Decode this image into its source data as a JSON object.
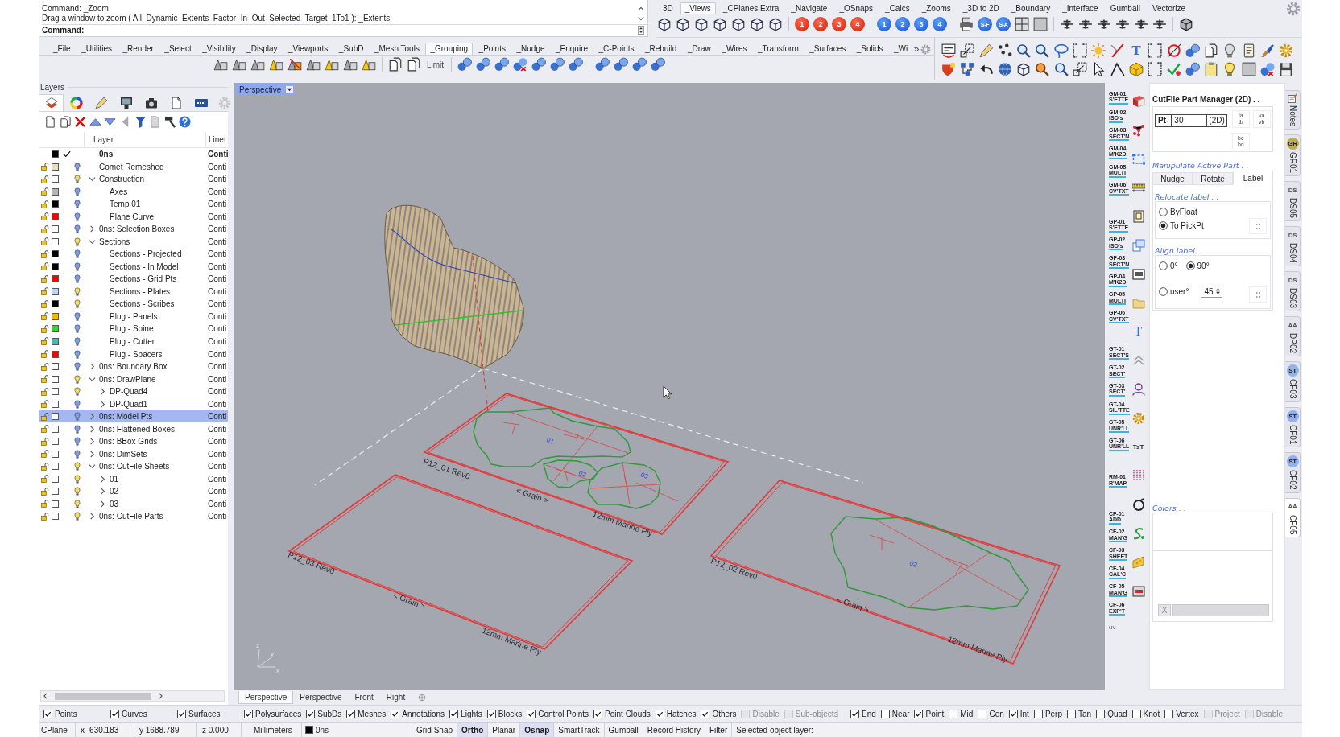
{
  "command_area": {
    "history": [
      "Command: _Zoom",
      "Drag a window to zoom ( All  Dynamic  Extents  Factor  In  Out  Selected  Target  1To1 ): _Extents"
    ],
    "prompt": "Command:"
  },
  "view_toolbar": {
    "tabs": [
      {
        "label": "3D",
        "selected": false
      },
      {
        "label": "_Views",
        "selected": true
      },
      {
        "label": "_CPlanes Extra",
        "selected": false
      },
      {
        "label": "_Navigate",
        "selected": false
      },
      {
        "label": "_OSnaps",
        "selected": false
      },
      {
        "label": "_Calcs",
        "selected": false
      },
      {
        "label": "_Zooms",
        "selected": false
      },
      {
        "label": "_3D to 2D",
        "selected": false
      },
      {
        "label": "_Boundary",
        "selected": false
      },
      {
        "label": "_Interface",
        "selected": false
      },
      {
        "label": "Gumball",
        "selected": false
      },
      {
        "label": "Vectorize",
        "selected": false
      }
    ],
    "red_buttons": [
      "1",
      "2",
      "3",
      "4"
    ],
    "blue_buttons": [
      "1",
      "2",
      "3",
      "4"
    ],
    "snap_buttons": [
      "S-F",
      "S-A"
    ]
  },
  "main_toolbar": {
    "tabs": [
      {
        "label": "_File",
        "selected": false
      },
      {
        "label": "_Utilities",
        "selected": false
      },
      {
        "label": "_Render",
        "selected": false
      },
      {
        "label": "_Select",
        "selected": false
      },
      {
        "label": "_Visibility",
        "selected": false
      },
      {
        "label": "_Display",
        "selected": false
      },
      {
        "label": "_Viewports",
        "selected": false
      },
      {
        "label": "_SubD",
        "selected": false
      },
      {
        "label": "_Mesh Tools",
        "selected": false
      },
      {
        "label": "_Grouping",
        "selected": true
      },
      {
        "label": "_Points",
        "selected": false
      },
      {
        "label": "_Nudge",
        "selected": false
      },
      {
        "label": "_Enquire",
        "selected": false
      },
      {
        "label": "_C-Points",
        "selected": false
      },
      {
        "label": "_Rebuild",
        "selected": false
      },
      {
        "label": "_Draw",
        "selected": false
      },
      {
        "label": "_Wires",
        "selected": false
      },
      {
        "label": "_Transform",
        "selected": false
      },
      {
        "label": "_Surfaces",
        "selected": false
      },
      {
        "label": "_Solids",
        "selected": false
      },
      {
        "label": "_Wi",
        "selected": false
      }
    ],
    "overflow": "»",
    "limit_button": "Limit",
    "text_button": "T"
  },
  "layers_panel": {
    "title": "Layers",
    "columns": [
      "Layer",
      "Linet"
    ],
    "layers": [
      {
        "name": "0ns",
        "color": "#000000",
        "current": true,
        "selected": false,
        "expandable": false,
        "linetype": "Conti"
      },
      {
        "name": "Comet Remeshed",
        "color": "#e9dcc2",
        "bulb": {
          "color": "#7d9fe2"
        },
        "current": false,
        "selected": false,
        "expandable": false,
        "linetype": "Conti"
      },
      {
        "name": "Construction",
        "color": "#ffffff",
        "bulb": {
          "color": "#f4dc5c"
        },
        "current": false,
        "selected": false,
        "expandable": true,
        "expanded": true,
        "linetype": "Conti",
        "children": [
          {
            "name": "Axes",
            "color": "#b4b4b4",
            "bulb": {
              "color": "#7d9fe2"
            },
            "current": false,
            "selected": false,
            "expandable": false,
            "linetype": "Conti"
          },
          {
            "name": "Temp 01",
            "color": "#000000",
            "bulb": {
              "color": "#7d9fe2"
            },
            "current": false,
            "selected": false,
            "expandable": false,
            "linetype": "Conti"
          },
          {
            "name": "Plane Curve",
            "color": "#ff0000",
            "bulb": {
              "color": "#7d9fe2"
            },
            "current": false,
            "selected": false,
            "expandable": false,
            "linetype": "Conti"
          }
        ]
      },
      {
        "name": "0ns: Selection Boxes",
        "color": "#ffffff",
        "bulb": {
          "color": "#7d9fe2"
        },
        "current": false,
        "selected": false,
        "expandable": true,
        "expanded": false,
        "linetype": "Conti"
      },
      {
        "name": "Sections",
        "color": "#ffffff",
        "bulb": {
          "color": "#f4dc5c"
        },
        "current": false,
        "selected": false,
        "expandable": true,
        "expanded": true,
        "linetype": "Conti",
        "children": [
          {
            "name": "Sections - Projected",
            "color": "#000000",
            "bulb": {
              "color": "#7d9fe2"
            },
            "current": false,
            "selected": false,
            "expandable": false,
            "linetype": "Conti"
          },
          {
            "name": "Sections - In Model",
            "color": "#000000",
            "bulb": {
              "color": "#7d9fe2"
            },
            "current": false,
            "selected": false,
            "expandable": false,
            "linetype": "Conti"
          },
          {
            "name": "Sections - Grid Pts",
            "color": "#ff0000",
            "bulb": {
              "color": "#7d9fe2"
            },
            "current": false,
            "selected": false,
            "expandable": false,
            "linetype": "Conti"
          },
          {
            "name": "Sections - Plates",
            "color": "#bcd7f2",
            "bulb": {
              "color": "#f4dc5c"
            },
            "current": false,
            "selected": false,
            "expandable": false,
            "linetype": "Conti"
          },
          {
            "name": "Sections - Scribes",
            "color": "#000000",
            "bulb": {
              "color": "#f4dc5c"
            },
            "current": false,
            "selected": false,
            "expandable": false,
            "linetype": "Conti"
          },
          {
            "name": "Plug - Panels",
            "color": "#f7b500",
            "bulb": {
              "color": "#7d9fe2"
            },
            "current": false,
            "selected": false,
            "expandable": false,
            "linetype": "Conti"
          },
          {
            "name": "Plug - Spine",
            "color": "#22e022",
            "bulb": {
              "color": "#7d9fe2"
            },
            "current": false,
            "selected": false,
            "expandable": false,
            "linetype": "Conti"
          },
          {
            "name": "Plug - Cutter",
            "color": "#3dbcb3",
            "bulb": {
              "color": "#7d9fe2"
            },
            "current": false,
            "selected": false,
            "expandable": false,
            "linetype": "Conti"
          },
          {
            "name": "Plug - Spacers",
            "color": "#ff0000",
            "bulb": {
              "color": "#7d9fe2"
            },
            "current": false,
            "selected": false,
            "expandable": false,
            "linetype": "Conti"
          }
        ]
      },
      {
        "name": "0ns: Boundary Box",
        "color": "#ffffff",
        "bulb": {
          "color": "#7d9fe2"
        },
        "current": false,
        "selected": false,
        "expandable": true,
        "expanded": false,
        "linetype": "Conti"
      },
      {
        "name": "0ns: DrawPlane",
        "color": "#ffffff",
        "bulb": {
          "color": "#f4dc5c"
        },
        "current": false,
        "selected": false,
        "expandable": true,
        "expanded": true,
        "linetype": "Conti",
        "children": [
          {
            "name": "DP-Quad4",
            "color": "#ffffff",
            "bulb": {
              "color": "#f4dc5c"
            },
            "current": false,
            "selected": false,
            "expandable": true,
            "expanded": false,
            "linetype": "Conti"
          },
          {
            "name": "DP-Quad1",
            "color": "#ffffff",
            "bulb": {
              "color": "#7d9fe2"
            },
            "current": false,
            "selected": false,
            "expandable": true,
            "expanded": false,
            "linetype": "Conti"
          }
        ]
      },
      {
        "name": "0ns: Model Pts",
        "color": "#ffffff",
        "bulb": {
          "color": "#7d9fe2"
        },
        "current": false,
        "selected": true,
        "expandable": true,
        "expanded": false,
        "linetype": "Conti"
      },
      {
        "name": "0ns: Flattened Boxes",
        "color": "#ffffff",
        "bulb": {
          "color": "#7d9fe2"
        },
        "current": false,
        "selected": false,
        "expandable": true,
        "expanded": false,
        "linetype": "Conti"
      },
      {
        "name": "0ns: BBox Grids",
        "color": "#ffffff",
        "bulb": {
          "color": "#7d9fe2"
        },
        "current": false,
        "selected": false,
        "expandable": true,
        "expanded": false,
        "linetype": "Conti"
      },
      {
        "name": "0ns: DimSets",
        "color": "#ffffff",
        "bulb": {
          "color": "#7d9fe2"
        },
        "current": false,
        "selected": false,
        "expandable": true,
        "expanded": false,
        "linetype": "Conti"
      },
      {
        "name": "0ns: CutFile Sheets",
        "color": "#ffffff",
        "bulb": {
          "color": "#f4dc5c"
        },
        "current": false,
        "selected": false,
        "expandable": true,
        "expanded": true,
        "linetype": "Conti",
        "children": [
          {
            "name": "01",
            "color": "#ffffff",
            "bulb": {
              "color": "#f4dc5c"
            },
            "current": false,
            "selected": false,
            "expandable": true,
            "expanded": false,
            "linetype": "Conti"
          },
          {
            "name": "02",
            "color": "#ffffff",
            "bulb": {
              "color": "#f4dc5c"
            },
            "current": false,
            "selected": false,
            "expandable": true,
            "expanded": false,
            "linetype": "Conti"
          },
          {
            "name": "03",
            "color": "#ffffff",
            "bulb": {
              "color": "#f4dc5c"
            },
            "current": false,
            "selected": false,
            "expandable": true,
            "expanded": false,
            "linetype": "Conti"
          }
        ]
      },
      {
        "name": "0ns: CutFile Parts",
        "color": "#ffffff",
        "bulb": {
          "color": "#f4dc5c"
        },
        "current": false,
        "selected": false,
        "expandable": true,
        "expanded": false,
        "linetype": "Conti"
      }
    ]
  },
  "viewport": {
    "label": "Perspective",
    "sheets": [
      {
        "name": "P12_01 Rev0",
        "grain": "< Grain >",
        "material": "12mm Marine Ply",
        "part_labels": [
          "01",
          "02",
          "03"
        ]
      },
      {
        "name": "P12_03 Rev0",
        "grain": "< Grain >",
        "material": "12mm Marine Ply"
      },
      {
        "name": "P12_02 Rev0",
        "grain": "< Grain >",
        "material": "12mm Marine Ply",
        "part_labels": [
          "02"
        ]
      }
    ],
    "axis_labels": [
      "z",
      "y",
      "x"
    ],
    "tabs": [
      {
        "label": "Perspective",
        "selected": true
      },
      {
        "label": "Perspective",
        "selected": false
      },
      {
        "label": "Front",
        "selected": false
      },
      {
        "label": "Right",
        "selected": false
      }
    ]
  },
  "side_toolbar": {
    "groups": [
      [
        [
          "GM-01",
          "S'ETTE"
        ],
        [
          "GM-02",
          "ISO's"
        ],
        [
          "GM-03",
          "SECT'N"
        ],
        [
          "GM-04",
          "M'K2D"
        ],
        [
          "GM-05",
          "MULTI"
        ],
        [
          "GM-06",
          "CV'TXT"
        ]
      ],
      [
        [
          "GP-01",
          "S'ETTE"
        ],
        [
          "GP-02",
          "ISO's"
        ],
        [
          "GP-03",
          "SECT'N"
        ],
        [
          "GP-04",
          "M'K2D"
        ],
        [
          "GP-05",
          "MULTI"
        ],
        [
          "GP-06",
          "CV'TXT"
        ]
      ],
      [
        [
          "GT-01",
          "SECT'S"
        ],
        [
          "GT-02",
          "SECT'"
        ],
        [
          "GT-03",
          "SECT'"
        ],
        [
          "GT-04",
          "SIL'TTE"
        ],
        [
          "GT-05",
          "UNR'LL"
        ],
        [
          "GT-06",
          "UNR'LL"
        ]
      ],
      [
        [
          "RM-01",
          "R'MAP"
        ]
      ],
      [
        [
          "CF-01",
          "ADD"
        ],
        [
          "CF-02",
          "MAN'G"
        ],
        [
          "CF-03",
          "SHEET"
        ],
        [
          "CF-04",
          "CAL'C"
        ],
        [
          "CF-05",
          "MAN'G"
        ],
        [
          "CF-06",
          "EXP'T"
        ],
        [
          "uv"
        ]
      ]
    ],
    "glyph_icons": [
      "T",
      "TsT"
    ]
  },
  "part_manager": {
    "title": "CutFile Part Manager (2D) . .",
    "field_label": "Pt-",
    "field_value": "30",
    "field_suffix": "(2D)",
    "small_buttons": [
      [
        "ta",
        "tb"
      ],
      [
        "va",
        "vb"
      ],
      [
        "bc",
        "bd"
      ]
    ],
    "section_title": "Manipulate Active Part . .",
    "tabs": [
      {
        "label": "Nudge",
        "selected": false
      },
      {
        "label": "Rotate",
        "selected": false
      },
      {
        "label": "Label",
        "selected": true
      }
    ],
    "relocate": {
      "title": "Relocate label . .",
      "options": [
        {
          "label": "ByFloat",
          "selected": false
        },
        {
          "label": "To PickPt",
          "selected": true
        }
      ]
    },
    "align": {
      "title": "Align label . .",
      "options": [
        {
          "label": "0°",
          "selected": false
        },
        {
          "label": "90°",
          "selected": true
        },
        {
          "label": "user°",
          "selected": false
        }
      ],
      "user_value": "45"
    },
    "colors_title": "Colors . .",
    "clear_button": "X"
  },
  "panel_tabs": [
    {
      "label": "Notes",
      "kind": "icon",
      "selected": false
    },
    {
      "label": "GR01",
      "kind": "badge",
      "badge": "GR",
      "color": "#bcae4c",
      "selected": false
    },
    {
      "label": "DS05",
      "kind": "badge",
      "badge": "DS",
      "selected": false
    },
    {
      "label": "DS04",
      "kind": "badge",
      "badge": "DS",
      "selected": false
    },
    {
      "label": "DS03",
      "kind": "badge",
      "badge": "DS",
      "selected": false
    },
    {
      "label": "DP02",
      "kind": "badge",
      "badge": "AA",
      "selected": false
    },
    {
      "label": "CF03",
      "kind": "badge",
      "badge": "ST",
      "color": "#92b2ea",
      "selected": false
    },
    {
      "label": "CF01",
      "kind": "badge",
      "badge": "ST",
      "color": "#92b2ea",
      "selected": false
    },
    {
      "label": "CF02",
      "kind": "badge",
      "badge": "ST",
      "color": "#92b2ea",
      "selected": false
    },
    {
      "label": "CF05",
      "kind": "badge",
      "badge": "AA",
      "selected": true
    }
  ],
  "snap_filters": {
    "object_types": [
      {
        "label": "Points",
        "checked": true,
        "disabled": false
      },
      {
        "label": "Curves",
        "checked": true,
        "disabled": false
      },
      {
        "label": "Surfaces",
        "checked": true,
        "disabled": false
      },
      {
        "label": "Polysurfaces",
        "checked": true,
        "disabled": false
      },
      {
        "label": "SubDs",
        "checked": true,
        "disabled": false
      },
      {
        "label": "Meshes",
        "checked": true,
        "disabled": false
      },
      {
        "label": "Annotations",
        "checked": true,
        "disabled": false
      },
      {
        "label": "Lights",
        "checked": true,
        "disabled": false
      },
      {
        "label": "Blocks",
        "checked": true,
        "disabled": false
      },
      {
        "label": "Control Points",
        "checked": true,
        "disabled": false
      },
      {
        "label": "Point Clouds",
        "checked": true,
        "disabled": false
      },
      {
        "label": "Hatches",
        "checked": true,
        "disabled": false
      },
      {
        "label": "Others",
        "checked": true,
        "disabled": false
      },
      {
        "label": "Disable",
        "checked": false,
        "disabled": true
      },
      {
        "label": "Sub-objects",
        "checked": false,
        "disabled": true
      }
    ],
    "osnaps": [
      {
        "label": "End",
        "checked": true,
        "disabled": false
      },
      {
        "label": "Near",
        "checked": false,
        "disabled": false
      },
      {
        "label": "Point",
        "checked": true,
        "disabled": false
      },
      {
        "label": "Mid",
        "checked": false,
        "disabled": false
      },
      {
        "label": "Cen",
        "checked": false,
        "disabled": false
      },
      {
        "label": "Int",
        "checked": true,
        "disabled": false
      },
      {
        "label": "Perp",
        "checked": false,
        "disabled": false
      },
      {
        "label": "Tan",
        "checked": false,
        "disabled": false
      },
      {
        "label": "Quad",
        "checked": false,
        "disabled": false
      },
      {
        "label": "Knot",
        "checked": false,
        "disabled": false
      },
      {
        "label": "Vertex",
        "checked": false,
        "disabled": false
      },
      {
        "label": "Project",
        "checked": false,
        "disabled": true
      },
      {
        "label": "Disable",
        "checked": false,
        "disabled": true
      }
    ]
  },
  "status_bar": {
    "cplane": "CPlane",
    "x": "x -630.183",
    "y": "y 1688.789",
    "z": "z 0.000",
    "units": "Millimeters",
    "layer": {
      "name": "0ns",
      "color": "#000000"
    },
    "toggles": [
      {
        "label": "Grid Snap",
        "on": false
      },
      {
        "label": "Ortho",
        "on": true
      },
      {
        "label": "Planar",
        "on": false
      },
      {
        "label": "Osnap",
        "on": true
      },
      {
        "label": "SmartTrack",
        "on": false
      },
      {
        "label": "Gumball",
        "on": false
      },
      {
        "label": "Record History",
        "on": false
      },
      {
        "label": "Filter",
        "on": false
      }
    ],
    "message": "Selected object layer:"
  }
}
